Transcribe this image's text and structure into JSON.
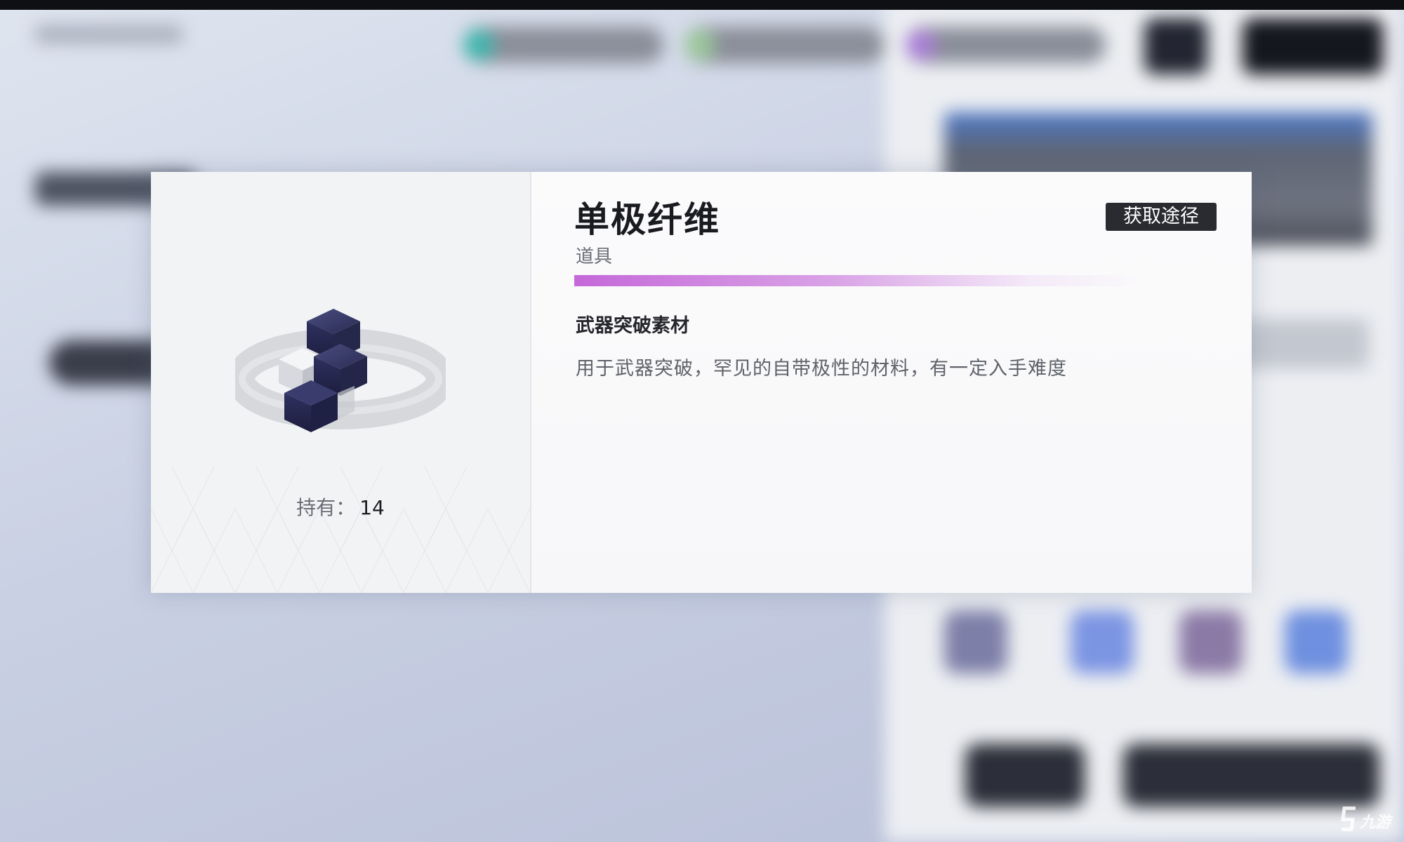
{
  "item": {
    "name": "单极纤维",
    "category": "道具",
    "usage_title": "武器突破素材",
    "description": "用于武器突破，罕见的自带极性的材料，有一定入手难度",
    "owned_label": "持有：",
    "owned_count": "14",
    "rarity_color": "#c568d9"
  },
  "actions": {
    "acquire_label": "获取途径"
  },
  "watermark": {
    "text": "九游"
  },
  "icons": {
    "item": "cube-cluster-icon",
    "watermark": "jiuyou-logo-icon"
  }
}
